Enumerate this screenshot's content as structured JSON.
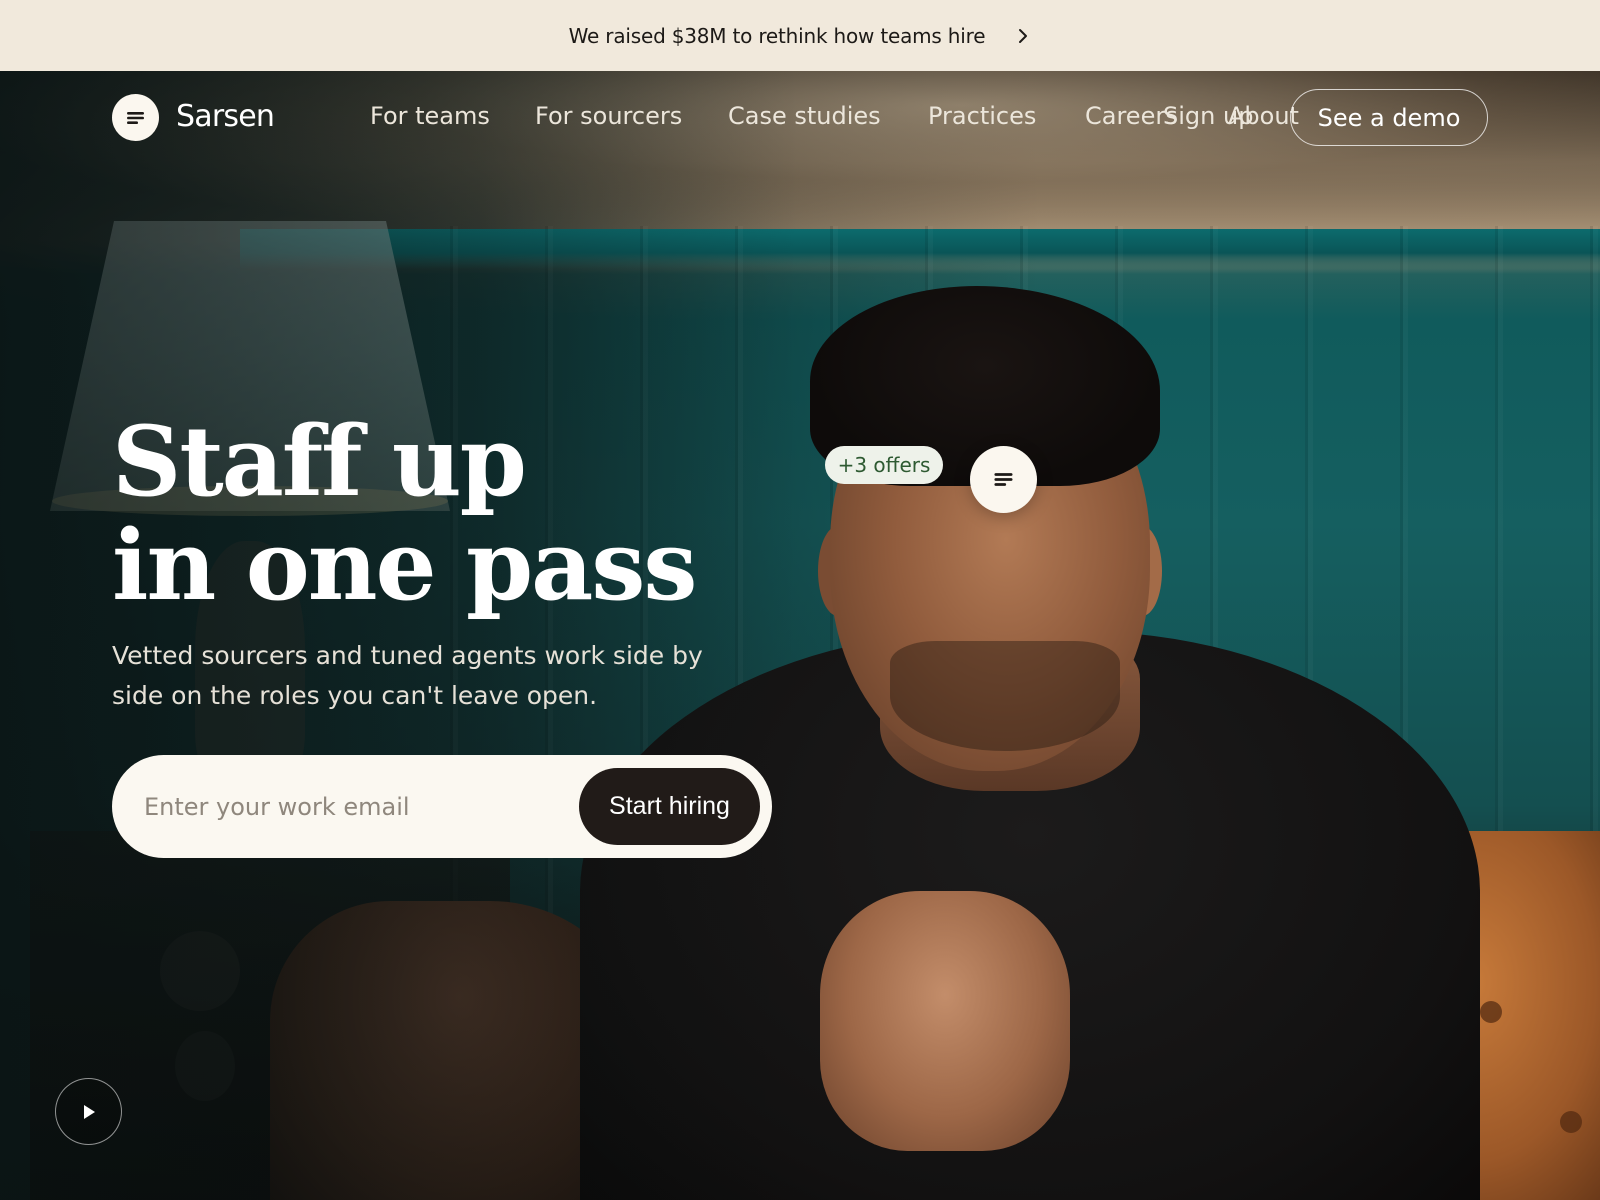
{
  "announcement": {
    "text": "We raised $38M to rethink how teams hire"
  },
  "brand": {
    "name": "Sarsen"
  },
  "nav": {
    "links": [
      "For teams",
      "For sourcers",
      "Case studies",
      "Practices",
      "Careers",
      "Sign up",
      "About"
    ],
    "demo_label": "See a demo"
  },
  "hero": {
    "headline_line1": "Staff up",
    "headline_line2": "in one pass",
    "subhead": "Vetted sourcers and tuned agents work side by side on the roles you can't leave open.",
    "email_placeholder": "Enter your work email",
    "cta_label": "Start hiring",
    "badge": "+3 offers"
  },
  "icons": {
    "logo": "lines-icon",
    "chevron": "chevron-right-icon",
    "play": "play-icon"
  },
  "colors": {
    "announcement_bg": "#f1e9dc",
    "cta_bg": "#211b18",
    "badge_text": "#2e5a32",
    "form_bg": "#fbf8f1"
  }
}
